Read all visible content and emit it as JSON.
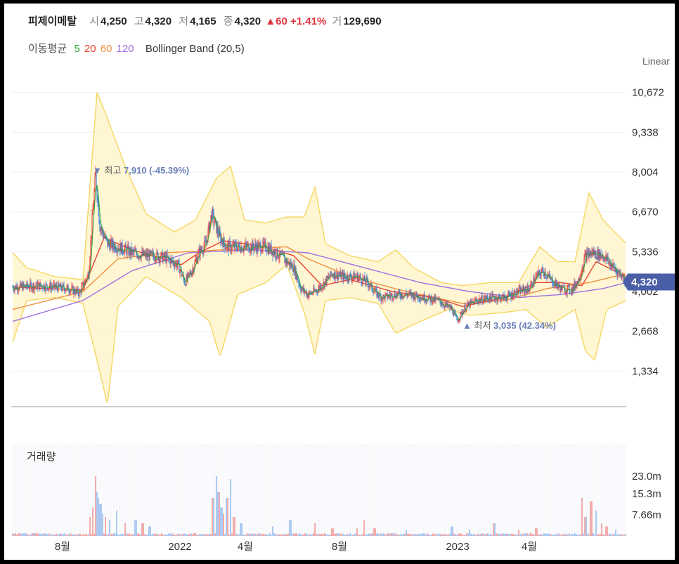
{
  "header": {
    "name": "피제이메탈",
    "open_label": "시",
    "open": "4,250",
    "high_label": "고",
    "high": "4,320",
    "low_label": "저",
    "low": "4,165",
    "close_label": "종",
    "close": "4,320",
    "change_arrow": "▲",
    "change": "60",
    "change_pct": "+1.41%",
    "volume_label": "거",
    "volume": "129,690"
  },
  "indicators": {
    "ma_label": "이동평균",
    "ma5": "5",
    "ma20": "20",
    "ma60": "60",
    "ma120": "120",
    "bb_label": "Bollinger Band (20,5)"
  },
  "scale_mode": "Linear",
  "colors": {
    "ma5": "#2aa43a",
    "ma20": "#e8402e",
    "ma60": "#f0903a",
    "ma120": "#a070e0",
    "bb_fill": "#fff4cc",
    "bb_line": "#f5d760",
    "up": "#e84a4a",
    "down": "#3b82d6",
    "accent": "#4a5fa8",
    "annotation": "#6a7fb8"
  },
  "chart_data": {
    "type": "candlestick",
    "ylim": [
      0,
      11300
    ],
    "y_ticks": [
      "10,672",
      "9,338",
      "8,004",
      "6,670",
      "5,336",
      "4,002",
      "2,668",
      "1,334"
    ],
    "x_ticks": [
      "8월",
      "2022",
      "4월",
      "8월",
      "2023",
      "4월"
    ],
    "current_price": "4,320",
    "annotations": {
      "high": {
        "marker": "▼",
        "label": "최고",
        "value": "7,910",
        "pct": "(-45.39%)"
      },
      "low": {
        "marker": "▲",
        "label": "최저",
        "value": "3,035",
        "pct": "(42.34%)"
      }
    },
    "price_keypoints": [
      [
        0,
        4150
      ],
      [
        40,
        4200
      ],
      [
        80,
        4100
      ],
      [
        95,
        3950
      ],
      [
        108,
        4600
      ],
      [
        114,
        6700
      ],
      [
        118,
        7910
      ],
      [
        124,
        6200
      ],
      [
        135,
        5600
      ],
      [
        150,
        5500
      ],
      [
        170,
        5300
      ],
      [
        190,
        5200
      ],
      [
        205,
        5200
      ],
      [
        220,
        5100
      ],
      [
        235,
        4900
      ],
      [
        245,
        4300
      ],
      [
        255,
        4700
      ],
      [
        265,
        5300
      ],
      [
        275,
        5600
      ],
      [
        283,
        6600
      ],
      [
        295,
        5800
      ],
      [
        305,
        5500
      ],
      [
        320,
        5500
      ],
      [
        340,
        5500
      ],
      [
        360,
        5500
      ],
      [
        375,
        5300
      ],
      [
        390,
        5000
      ],
      [
        400,
        4800
      ],
      [
        410,
        4100
      ],
      [
        420,
        3900
      ],
      [
        430,
        4000
      ],
      [
        440,
        4200
      ],
      [
        455,
        4600
      ],
      [
        470,
        4500
      ],
      [
        490,
        4500
      ],
      [
        505,
        4300
      ],
      [
        515,
        4000
      ],
      [
        525,
        3800
      ],
      [
        545,
        3900
      ],
      [
        565,
        3900
      ],
      [
        585,
        3800
      ],
      [
        605,
        3700
      ],
      [
        625,
        3400
      ],
      [
        632,
        3035
      ],
      [
        645,
        3500
      ],
      [
        660,
        3700
      ],
      [
        680,
        3800
      ],
      [
        700,
        3800
      ],
      [
        720,
        4000
      ],
      [
        735,
        4100
      ],
      [
        745,
        4500
      ],
      [
        755,
        4700
      ],
      [
        765,
        4400
      ],
      [
        780,
        4100
      ],
      [
        795,
        4050
      ],
      [
        805,
        4400
      ],
      [
        815,
        5200
      ],
      [
        825,
        5300
      ],
      [
        840,
        5200
      ],
      [
        855,
        4800
      ],
      [
        868,
        4500
      ],
      [
        873,
        4320
      ]
    ],
    "ma_keypoints": {
      "ma20": [
        [
          0,
          4150
        ],
        [
          100,
          4050
        ],
        [
          130,
          5800
        ],
        [
          170,
          5400
        ],
        [
          240,
          4900
        ],
        [
          265,
          5300
        ],
        [
          300,
          5700
        ],
        [
          360,
          5500
        ],
        [
          400,
          5200
        ],
        [
          440,
          4200
        ],
        [
          480,
          4400
        ],
        [
          540,
          4000
        ],
        [
          600,
          3800
        ],
        [
          640,
          3500
        ],
        [
          700,
          3800
        ],
        [
          745,
          4300
        ],
        [
          780,
          4300
        ],
        [
          810,
          4200
        ],
        [
          830,
          5000
        ],
        [
          873,
          4500
        ]
      ],
      "ma60": [
        [
          0,
          3400
        ],
        [
          100,
          4000
        ],
        [
          150,
          5100
        ],
        [
          220,
          5300
        ],
        [
          300,
          5400
        ],
        [
          390,
          5500
        ],
        [
          420,
          5100
        ],
        [
          480,
          4500
        ],
        [
          560,
          4000
        ],
        [
          640,
          3600
        ],
        [
          700,
          3700
        ],
        [
          760,
          4100
        ],
        [
          820,
          4300
        ],
        [
          873,
          4600
        ]
      ],
      "ma120": [
        [
          0,
          3000
        ],
        [
          100,
          3700
        ],
        [
          170,
          4700
        ],
        [
          250,
          5300
        ],
        [
          340,
          5400
        ],
        [
          420,
          5300
        ],
        [
          500,
          4800
        ],
        [
          580,
          4300
        ],
        [
          650,
          4000
        ],
        [
          720,
          3800
        ],
        [
          780,
          3900
        ],
        [
          840,
          4100
        ],
        [
          873,
          4300
        ]
      ],
      "bb_upper": [
        [
          0,
          5300
        ],
        [
          20,
          4800
        ],
        [
          60,
          4500
        ],
        [
          100,
          4400
        ],
        [
          120,
          10672
        ],
        [
          135,
          9800
        ],
        [
          160,
          8200
        ],
        [
          190,
          6600
        ],
        [
          230,
          6000
        ],
        [
          260,
          6400
        ],
        [
          290,
          7800
        ],
        [
          310,
          8200
        ],
        [
          330,
          6400
        ],
        [
          360,
          6300
        ],
        [
          390,
          6500
        ],
        [
          415,
          6500
        ],
        [
          430,
          7500
        ],
        [
          445,
          5600
        ],
        [
          480,
          5200
        ],
        [
          520,
          5000
        ],
        [
          545,
          5400
        ],
        [
          570,
          4800
        ],
        [
          610,
          4300
        ],
        [
          640,
          4200
        ],
        [
          680,
          4300
        ],
        [
          720,
          4300
        ],
        [
          750,
          5500
        ],
        [
          775,
          5000
        ],
        [
          800,
          5000
        ],
        [
          820,
          7300
        ],
        [
          840,
          6400
        ],
        [
          873,
          5600
        ]
      ],
      "bb_lower": [
        [
          0,
          2300
        ],
        [
          20,
          3700
        ],
        [
          60,
          3800
        ],
        [
          100,
          3600
        ],
        [
          120,
          1700
        ],
        [
          135,
          200
        ],
        [
          150,
          3500
        ],
        [
          190,
          4500
        ],
        [
          240,
          3800
        ],
        [
          280,
          3000
        ],
        [
          295,
          1800
        ],
        [
          320,
          3900
        ],
        [
          360,
          4300
        ],
        [
          390,
          4900
        ],
        [
          415,
          3300
        ],
        [
          430,
          1900
        ],
        [
          445,
          3700
        ],
        [
          480,
          3800
        ],
        [
          520,
          3600
        ],
        [
          545,
          2600
        ],
        [
          580,
          3000
        ],
        [
          620,
          3400
        ],
        [
          650,
          3200
        ],
        [
          700,
          3300
        ],
        [
          730,
          3400
        ],
        [
          760,
          2800
        ],
        [
          800,
          3400
        ],
        [
          815,
          2000
        ],
        [
          828,
          1700
        ],
        [
          845,
          3400
        ],
        [
          873,
          3700
        ]
      ]
    },
    "volume_ticks": [
      "23.0m",
      "15.3m",
      "7.66m"
    ],
    "volume_spikes": [
      [
        110,
        0.3
      ],
      [
        114,
        0.45
      ],
      [
        118,
        0.95
      ],
      [
        120,
        0.7
      ],
      [
        122,
        0.6
      ],
      [
        125,
        0.5
      ],
      [
        128,
        0.35
      ],
      [
        132,
        0.3
      ],
      [
        138,
        0.25
      ],
      [
        148,
        0.4
      ],
      [
        160,
        0.2
      ],
      [
        175,
        0.25
      ],
      [
        185,
        0.2
      ],
      [
        195,
        0.15
      ],
      [
        285,
        0.6
      ],
      [
        290,
        0.95
      ],
      [
        293,
        0.7
      ],
      [
        297,
        0.45
      ],
      [
        300,
        0.35
      ],
      [
        305,
        0.6
      ],
      [
        310,
        0.9
      ],
      [
        315,
        0.3
      ],
      [
        325,
        0.2
      ],
      [
        370,
        0.15
      ],
      [
        395,
        0.25
      ],
      [
        430,
        0.2
      ],
      [
        455,
        0.12
      ],
      [
        490,
        0.12
      ],
      [
        500,
        0.25
      ],
      [
        515,
        0.12
      ],
      [
        560,
        0.1
      ],
      [
        625,
        0.15
      ],
      [
        650,
        0.1
      ],
      [
        685,
        0.2
      ],
      [
        720,
        0.1
      ],
      [
        745,
        0.12
      ],
      [
        810,
        0.6
      ],
      [
        815,
        0.3
      ],
      [
        823,
        0.55
      ],
      [
        830,
        0.4
      ],
      [
        838,
        0.2
      ],
      [
        845,
        0.15
      ],
      [
        858,
        0.1
      ]
    ]
  }
}
